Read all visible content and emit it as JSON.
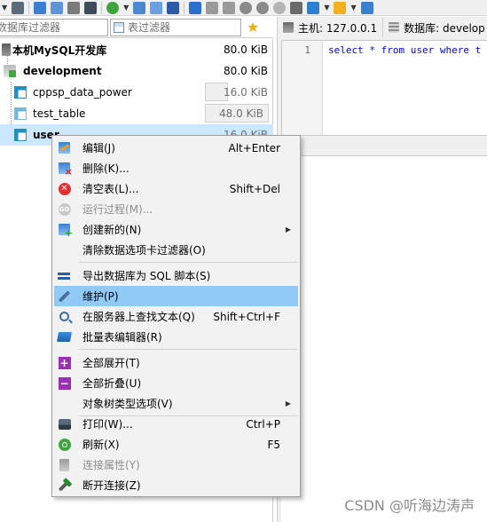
{
  "filters": {
    "db_filter_placeholder": "数据库过滤器",
    "table_filter_placeholder": "表过滤器"
  },
  "tree": {
    "server": {
      "label": "本机MySQL开发库",
      "size": "80.0 KiB"
    },
    "database": {
      "label": "development",
      "size": "80.0 KiB"
    },
    "tables": [
      {
        "label": "cppsp_data_power",
        "size": "16.0 KiB"
      },
      {
        "label": "test_table",
        "size": "48.0 KiB"
      },
      {
        "label": "user",
        "size": "16.0 KiB"
      }
    ]
  },
  "tabs": {
    "host": "主机: 127.0.0.1",
    "database": "数据库: develop"
  },
  "editor": {
    "line_number": "1",
    "code": "select * from user where t"
  },
  "context_menu": {
    "items": [
      {
        "label": "编辑(J)",
        "shortcut": "Alt+Enter",
        "icon": "edit-icon",
        "disabled": false
      },
      {
        "label": "删除(K)...",
        "shortcut": "",
        "icon": "delete-icon",
        "disabled": false
      },
      {
        "label": "清空表(L)...",
        "shortcut": "Shift+Del",
        "icon": "clear-table-icon",
        "disabled": false
      },
      {
        "label": "运行过程(M)...",
        "shortcut": "",
        "icon": "run-routine-icon",
        "disabled": true
      },
      {
        "label": "创建新的(N)",
        "shortcut": "",
        "icon": "create-new-icon",
        "disabled": false,
        "submenu": true
      },
      {
        "label": "清除数据选项卡过滤器(O)",
        "shortcut": "",
        "icon": "",
        "disabled": false
      },
      {
        "label": "导出数据库为 SQL 脚本(S)",
        "shortcut": "",
        "icon": "export-sql-icon",
        "disabled": false
      },
      {
        "label": "维护(P)",
        "shortcut": "",
        "icon": "wrench-icon",
        "disabled": false,
        "hovered": true
      },
      {
        "label": "在服务器上查找文本(Q)",
        "shortcut": "Shift+Ctrl+F",
        "icon": "search-icon",
        "disabled": false
      },
      {
        "label": "批量表编辑器(R)",
        "shortcut": "",
        "icon": "bulk-editor-icon",
        "disabled": false
      },
      {
        "label": "全部展开(T)",
        "shortcut": "",
        "icon": "expand-all-icon",
        "disabled": false
      },
      {
        "label": "全部折叠(U)",
        "shortcut": "",
        "icon": "collapse-all-icon",
        "disabled": false
      },
      {
        "label": "对象树类型选项(V)",
        "shortcut": "",
        "icon": "",
        "disabled": false,
        "submenu": true
      },
      {
        "label": "打印(W)...",
        "shortcut": "Ctrl+P",
        "icon": "print-icon",
        "disabled": false
      },
      {
        "label": "刷新(X)",
        "shortcut": "F5",
        "icon": "refresh-icon",
        "disabled": false
      },
      {
        "label": "连接属性(Y)",
        "shortcut": "",
        "icon": "connection-properties-icon",
        "disabled": true
      },
      {
        "label": "断开连接(Z)",
        "shortcut": "",
        "icon": "disconnect-icon",
        "disabled": false
      }
    ]
  },
  "watermark": "CSDN @听海边涛声",
  "colors": {
    "selection": "#cce8ff",
    "menu_hover": "#91c9f7",
    "keyword": "#0000ff"
  }
}
